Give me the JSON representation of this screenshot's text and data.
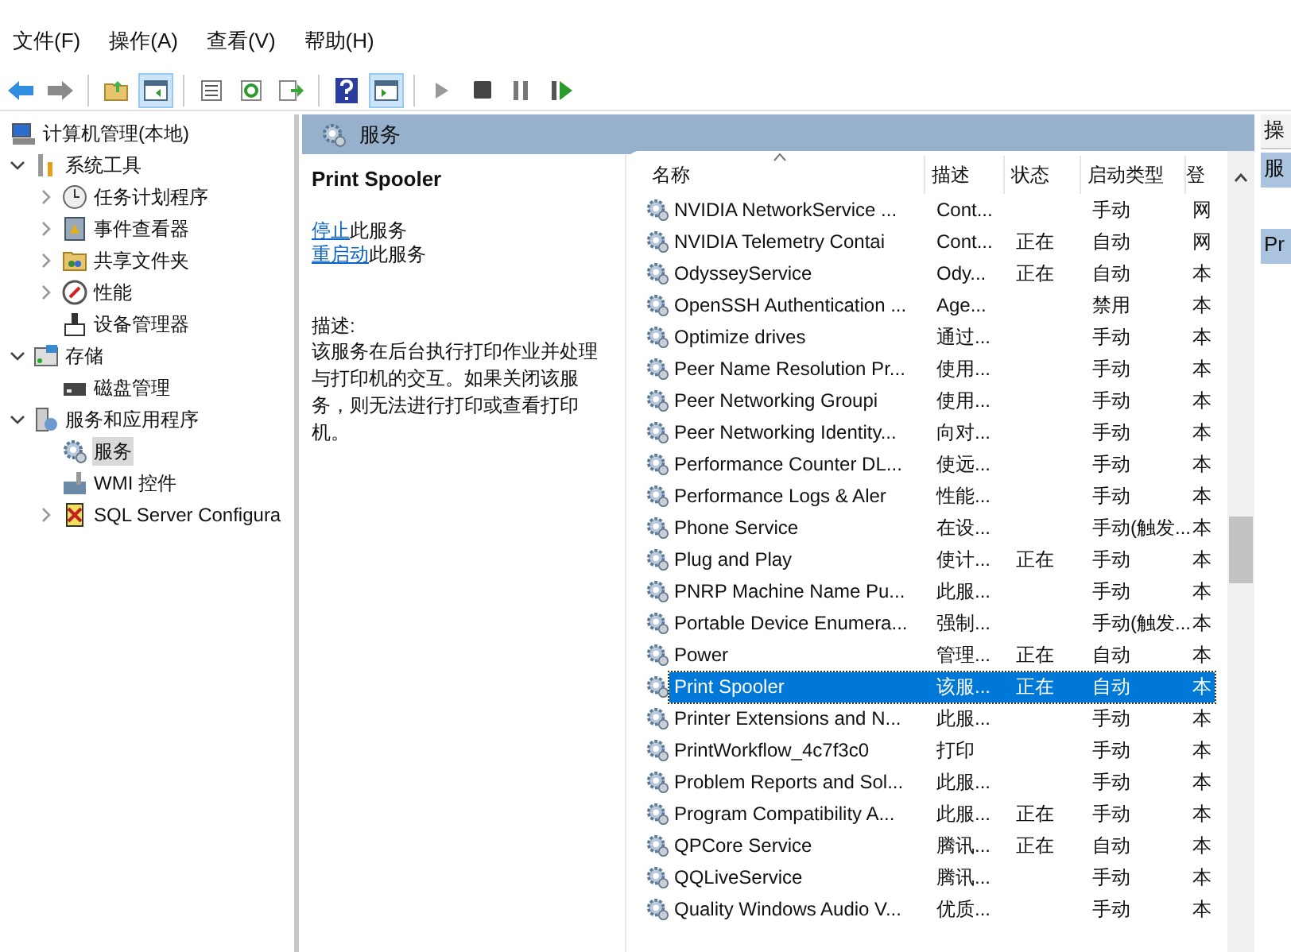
{
  "menu": [
    "文件(F)",
    "操作(A)",
    "查看(V)",
    "帮助(H)"
  ],
  "toolbar": [
    {
      "kind": "back",
      "pressed": false
    },
    {
      "kind": "forward",
      "pressed": false
    },
    {
      "kind": "sep"
    },
    {
      "kind": "up",
      "pressed": false
    },
    {
      "kind": "pane",
      "pressed": true
    },
    {
      "kind": "sep"
    },
    {
      "kind": "props",
      "pressed": false
    },
    {
      "kind": "refresh",
      "pressed": false
    },
    {
      "kind": "export",
      "pressed": false
    },
    {
      "kind": "sep"
    },
    {
      "kind": "help",
      "pressed": false
    },
    {
      "kind": "action",
      "pressed": true
    },
    {
      "kind": "sep"
    },
    {
      "kind": "play",
      "pressed": false
    },
    {
      "kind": "stop",
      "pressed": false
    },
    {
      "kind": "pause",
      "pressed": false
    },
    {
      "kind": "resume",
      "pressed": false
    }
  ],
  "tree": {
    "label": "计算机管理(本地)",
    "selected": false,
    "children": [
      {
        "label": "系统工具",
        "expanded": true,
        "selected": false,
        "children": [
          {
            "label": "任务计划程序",
            "expanded": false,
            "selected": false
          },
          {
            "label": "事件查看器",
            "expanded": false,
            "selected": false
          },
          {
            "label": "共享文件夹",
            "expanded": false,
            "selected": false
          },
          {
            "label": "性能",
            "expanded": false,
            "selected": false
          },
          {
            "label": "设备管理器",
            "selected": false
          }
        ]
      },
      {
        "label": "存储",
        "expanded": true,
        "selected": false,
        "children": [
          {
            "label": "磁盘管理",
            "selected": false
          }
        ]
      },
      {
        "label": "服务和应用程序",
        "expanded": true,
        "selected": false,
        "children": [
          {
            "label": "服务",
            "selected": true
          },
          {
            "label": "WMI 控件",
            "selected": false
          },
          {
            "label": "SQL Server Configura",
            "expanded": false,
            "selected": false
          }
        ]
      }
    ]
  },
  "pane_header": "服务",
  "detail": {
    "title": "Print Spooler",
    "links": [
      {
        "link": "停止",
        "rest": "此服务"
      },
      {
        "link": "重启动",
        "rest": "此服务"
      }
    ],
    "description_label": "描述:",
    "description": "该服务在后台执行打印作业并处理与打印机的交互。如果关闭该服务，则无法进行打印或查看打印机。"
  },
  "table": {
    "columns": [
      "名称",
      "描述",
      "状态",
      "启动类型",
      "登"
    ],
    "rows": [
      {
        "cells": [
          "NVIDIA NetworkService ...",
          "Cont...",
          "",
          "手动",
          "网"
        ],
        "selected": false
      },
      {
        "cells": [
          "NVIDIA Telemetry Contai",
          "Cont...",
          "正在",
          "自动",
          "网"
        ],
        "selected": false
      },
      {
        "cells": [
          "OdysseyService",
          "Ody...",
          "正在",
          "自动",
          "本"
        ],
        "selected": false
      },
      {
        "cells": [
          "OpenSSH Authentication ...",
          "Age...",
          "",
          "禁用",
          "本"
        ],
        "selected": false
      },
      {
        "cells": [
          "Optimize drives",
          "通过...",
          "",
          "手动",
          "本"
        ],
        "selected": false
      },
      {
        "cells": [
          "Peer Name Resolution Pr...",
          "使用...",
          "",
          "手动",
          "本"
        ],
        "selected": false
      },
      {
        "cells": [
          "Peer Networking Groupi",
          "使用...",
          "",
          "手动",
          "本"
        ],
        "selected": false
      },
      {
        "cells": [
          "Peer Networking Identity...",
          "向对...",
          "",
          "手动",
          "本"
        ],
        "selected": false
      },
      {
        "cells": [
          "Performance Counter DL...",
          "使远...",
          "",
          "手动",
          "本"
        ],
        "selected": false
      },
      {
        "cells": [
          "Performance Logs & Aler",
          "性能...",
          "",
          "手动",
          "本"
        ],
        "selected": false
      },
      {
        "cells": [
          "Phone Service",
          "在设...",
          "",
          "手动(触发...",
          "本"
        ],
        "selected": false
      },
      {
        "cells": [
          "Plug and Play",
          "使计...",
          "正在",
          "手动",
          "本"
        ],
        "selected": false
      },
      {
        "cells": [
          "PNRP Machine Name Pu...",
          "此服...",
          "",
          "手动",
          "本"
        ],
        "selected": false
      },
      {
        "cells": [
          "Portable Device Enumera...",
          "强制...",
          "",
          "手动(触发...",
          "本"
        ],
        "selected": false
      },
      {
        "cells": [
          "Power",
          "管理...",
          "正在",
          "自动",
          "本"
        ],
        "selected": false
      },
      {
        "cells": [
          "Print Spooler",
          "该服...",
          "正在",
          "自动",
          "本"
        ],
        "selected": true
      },
      {
        "cells": [
          "Printer Extensions and N...",
          "此服...",
          "",
          "手动",
          "本"
        ],
        "selected": false
      },
      {
        "cells": [
          "PrintWorkflow_4c7f3c0",
          "打印",
          "",
          "手动",
          "本"
        ],
        "selected": false
      },
      {
        "cells": [
          "Problem Reports and Sol...",
          "此服...",
          "",
          "手动",
          "本"
        ],
        "selected": false
      },
      {
        "cells": [
          "Program Compatibility A...",
          "此服...",
          "正在",
          "手动",
          "本"
        ],
        "selected": false
      },
      {
        "cells": [
          "QPCore Service",
          "腾讯...",
          "正在",
          "自动",
          "本"
        ],
        "selected": false
      },
      {
        "cells": [
          "QQLiveService",
          "腾讯...",
          "",
          "手动",
          "本"
        ],
        "selected": false
      },
      {
        "cells": [
          "Quality Windows Audio V...",
          "优质...",
          "",
          "手动",
          "本"
        ],
        "selected": false
      }
    ]
  },
  "actions": {
    "header": "操",
    "items": [
      {
        "label": "服",
        "selected": true
      },
      {
        "label": "Pr",
        "selected": true
      }
    ]
  }
}
